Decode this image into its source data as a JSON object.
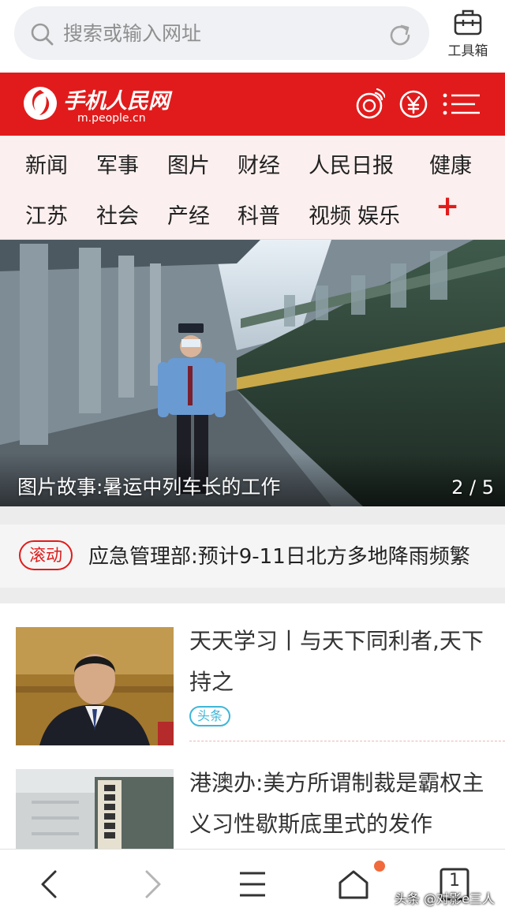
{
  "search": {
    "placeholder": "搜索或输入网址",
    "icon": "search-icon",
    "refresh_icon": "refresh-icon"
  },
  "toolbox": {
    "label": "工具箱",
    "icon": "toolbox-icon"
  },
  "header": {
    "logo_text": "手机人民网",
    "logo_url": "m.people.cn",
    "accent": "#e11b1b"
  },
  "nav": {
    "row1": [
      "新闻",
      "军事",
      "图片",
      "财经",
      "人民日报",
      "健康"
    ],
    "row2": [
      "江苏",
      "社会",
      "产经",
      "科普",
      "视频",
      "娱乐"
    ],
    "more": "+"
  },
  "hero": {
    "caption": "图片故事:暑运中列车长的工作",
    "pager": "2 / 5"
  },
  "ticker": {
    "badge": "滚动",
    "text": "应急管理部:预计9-11日北方多地降雨频繁"
  },
  "articles": [
    {
      "title": "天天学习丨与天下同利者,天下持之",
      "tag": "头条"
    },
    {
      "title": "港澳办:美方所谓制裁是霸权主义习性歇斯底里式的发作"
    }
  ],
  "bottom": {
    "tab_count": "1",
    "notification_color": "#f06a3c"
  },
  "watermark": "头条 @对影e三人"
}
